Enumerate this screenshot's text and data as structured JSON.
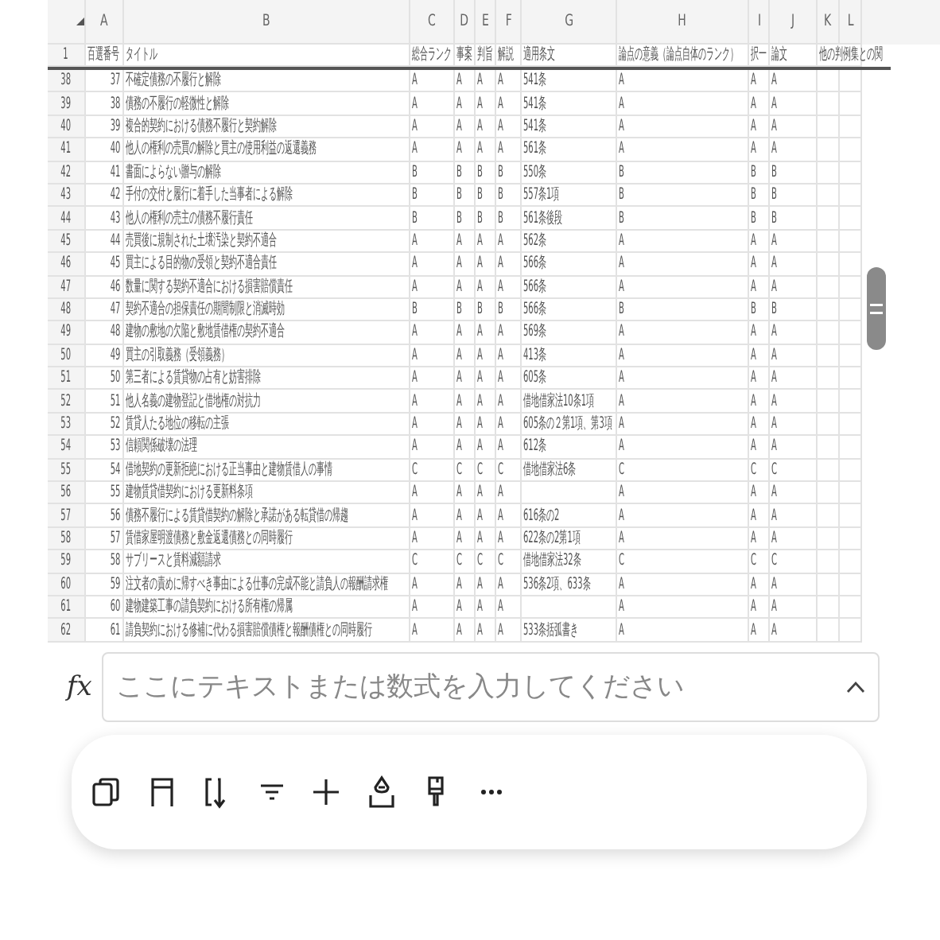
{
  "sheet": {
    "column_letters": [
      "A",
      "B",
      "C",
      "D",
      "E",
      "F",
      "G",
      "H",
      "I",
      "J",
      "K",
      "L"
    ],
    "header_row": {
      "row_number": "1",
      "number": "百選番号",
      "title": "タイトル",
      "overall": "総合ランク",
      "facts": "事案",
      "holding": "判旨",
      "commentary": "解説",
      "article": "適用条文",
      "significance": "論点の意義（論点自体のランク）",
      "mc": "択一",
      "essay": "論文",
      "relations": "他の判例集との関"
    },
    "rows": [
      {
        "row_number": "38",
        "number": "37",
        "title": "不確定債務の不履行と解除",
        "overall": "A",
        "facts": "A",
        "holding": "A",
        "commentary": "A",
        "article": "541条",
        "significance": "A",
        "mc": "A",
        "essay": "A"
      },
      {
        "row_number": "39",
        "number": "38",
        "title": "債務の不履行の軽微性と解除",
        "overall": "A",
        "facts": "A",
        "holding": "A",
        "commentary": "A",
        "article": "541条",
        "significance": "A",
        "mc": "A",
        "essay": "A"
      },
      {
        "row_number": "40",
        "number": "39",
        "title": "複合的契約における債務不履行と契約解除",
        "overall": "A",
        "facts": "A",
        "holding": "A",
        "commentary": "A",
        "article": "541条",
        "significance": "A",
        "mc": "A",
        "essay": "A"
      },
      {
        "row_number": "41",
        "number": "40",
        "title": "他人の権利の売買の解除と買主の使用利益の返還義務",
        "overall": "A",
        "facts": "A",
        "holding": "A",
        "commentary": "A",
        "article": "561条",
        "significance": "A",
        "mc": "A",
        "essay": "A"
      },
      {
        "row_number": "42",
        "number": "41",
        "title": "書面によらない贈与の解除",
        "overall": "B",
        "facts": "B",
        "holding": "B",
        "commentary": "B",
        "article": "550条",
        "significance": "B",
        "mc": "B",
        "essay": "B"
      },
      {
        "row_number": "43",
        "number": "42",
        "title": "手付の交付と履行に着手した当事者による解除",
        "overall": "B",
        "facts": "B",
        "holding": "B",
        "commentary": "B",
        "article": "557条1項",
        "significance": "B",
        "mc": "B",
        "essay": "B"
      },
      {
        "row_number": "44",
        "number": "43",
        "title": "他人の権利の売主の債務不履行責任",
        "overall": "B",
        "facts": "B",
        "holding": "B",
        "commentary": "B",
        "article": "561条後段",
        "significance": "B",
        "mc": "B",
        "essay": "B"
      },
      {
        "row_number": "45",
        "number": "44",
        "title": "売買後に規制された土壌汚染と契約不適合",
        "overall": "A",
        "facts": "A",
        "holding": "A",
        "commentary": "A",
        "article": "562条",
        "significance": "A",
        "mc": "A",
        "essay": "A"
      },
      {
        "row_number": "46",
        "number": "45",
        "title": "買主による目的物の受領と契約不適合責任",
        "overall": "A",
        "facts": "A",
        "holding": "A",
        "commentary": "A",
        "article": "566条",
        "significance": "A",
        "mc": "A",
        "essay": "A"
      },
      {
        "row_number": "47",
        "number": "46",
        "title": "数量に関する契約不適合における損害賠償責任",
        "overall": "A",
        "facts": "A",
        "holding": "A",
        "commentary": "A",
        "article": "566条",
        "significance": "A",
        "mc": "A",
        "essay": "A"
      },
      {
        "row_number": "48",
        "number": "47",
        "title": "契約不適合の担保責任の期間制限と消滅時効",
        "overall": "B",
        "facts": "B",
        "holding": "B",
        "commentary": "B",
        "article": "566条",
        "significance": "B",
        "mc": "B",
        "essay": "B"
      },
      {
        "row_number": "49",
        "number": "48",
        "title": "建物の敷地の欠陥と敷地賃借権の契約不適合",
        "overall": "A",
        "facts": "A",
        "holding": "A",
        "commentary": "A",
        "article": "569条",
        "significance": "A",
        "mc": "A",
        "essay": "A"
      },
      {
        "row_number": "50",
        "number": "49",
        "title": "買主の引取義務（受領義務）",
        "overall": "A",
        "facts": "A",
        "holding": "A",
        "commentary": "A",
        "article": "413条",
        "significance": "A",
        "mc": "A",
        "essay": "A"
      },
      {
        "row_number": "51",
        "number": "50",
        "title": "第三者による賃貸物の占有と妨害排除",
        "overall": "A",
        "facts": "A",
        "holding": "A",
        "commentary": "A",
        "article": "605条",
        "significance": "A",
        "mc": "A",
        "essay": "A"
      },
      {
        "row_number": "52",
        "number": "51",
        "title": "他人名義の建物登記と借地権の対抗力",
        "overall": "A",
        "facts": "A",
        "holding": "A",
        "commentary": "A",
        "article": "借地借家法10条1項",
        "significance": "A",
        "mc": "A",
        "essay": "A"
      },
      {
        "row_number": "53",
        "number": "52",
        "title": "賃貸人たる地位の移転の主張",
        "overall": "A",
        "facts": "A",
        "holding": "A",
        "commentary": "A",
        "article": "605条の２第1項、第3項",
        "significance": "A",
        "mc": "A",
        "essay": "A"
      },
      {
        "row_number": "54",
        "number": "53",
        "title": "信頼関係破壊の法理",
        "overall": "A",
        "facts": "A",
        "holding": "A",
        "commentary": "A",
        "article": "612条",
        "significance": "A",
        "mc": "A",
        "essay": "A"
      },
      {
        "row_number": "55",
        "number": "54",
        "title": "借地契約の更新拒絶における正当事由と建物賃借人の事情",
        "overall": "C",
        "facts": "C",
        "holding": "C",
        "commentary": "C",
        "article": "借地借家法6条",
        "significance": "C",
        "mc": "C",
        "essay": "C"
      },
      {
        "row_number": "56",
        "number": "55",
        "title": "建物賃貸借契約における更新料条項",
        "overall": "A",
        "facts": "A",
        "holding": "A",
        "commentary": "A",
        "significance": "A",
        "mc": "A",
        "essay": "A"
      },
      {
        "row_number": "57",
        "number": "56",
        "title": "債務不履行による賃貸借契約の解除と承諾がある転貸借の帰趨",
        "overall": "A",
        "facts": "A",
        "holding": "A",
        "commentary": "A",
        "article": "616条の2",
        "significance": "A",
        "mc": "A",
        "essay": "A"
      },
      {
        "row_number": "58",
        "number": "57",
        "title": "賃借家屋明渡債務と敷金返還債務との同時履行",
        "overall": "A",
        "facts": "A",
        "holding": "A",
        "commentary": "A",
        "article": "622条の2第1項",
        "significance": "A",
        "mc": "A",
        "essay": "A"
      },
      {
        "row_number": "59",
        "number": "58",
        "title": "サブリースと賃料減額請求",
        "overall": "C",
        "facts": "C",
        "holding": "C",
        "commentary": "C",
        "article": "借地借家法32条",
        "significance": "C",
        "mc": "C",
        "essay": "C"
      },
      {
        "row_number": "60",
        "number": "59",
        "title": "注文者の責めに帰すべき事由による仕事の完成不能と請負人の報酬請求権",
        "overall": "A",
        "facts": "A",
        "holding": "A",
        "commentary": "A",
        "article": "536条2項、633条",
        "significance": "A",
        "mc": "A",
        "essay": "A"
      },
      {
        "row_number": "61",
        "number": "60",
        "title": "建物建築工事の請負契約における所有権の帰属",
        "overall": "A",
        "facts": "A",
        "holding": "A",
        "commentary": "A",
        "significance": "A",
        "mc": "A",
        "essay": "A"
      },
      {
        "row_number": "62",
        "number": "61",
        "title": "請負契約における修補に代わる損害賠償債権と報酬債権との同時履行",
        "overall": "A",
        "facts": "A",
        "holding": "A",
        "commentary": "A",
        "article": "533条括弧書き",
        "significance": "A",
        "mc": "A",
        "essay": "A"
      }
    ]
  },
  "formula_bar": {
    "function_label": "fx",
    "placeholder": "ここにテキストまたは数式を入力してください"
  },
  "toolbar": {
    "buttons": [
      {
        "kind": "copy"
      },
      {
        "kind": "freeze"
      },
      {
        "kind": "sort"
      },
      {
        "kind": "filter"
      },
      {
        "kind": "add"
      },
      {
        "kind": "fill"
      },
      {
        "kind": "format"
      },
      {
        "kind": "more"
      }
    ]
  }
}
